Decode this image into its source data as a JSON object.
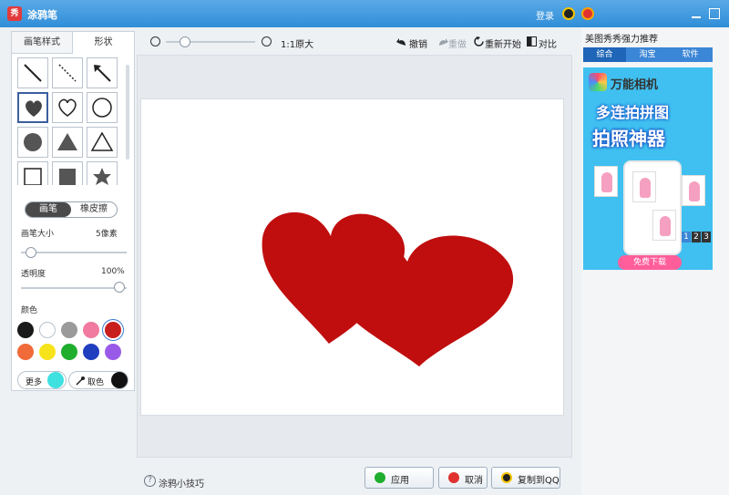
{
  "window": {
    "title": "涂鸦笔",
    "logo_char": "秀",
    "login_label": "登录"
  },
  "left_panel": {
    "tabs": [
      {
        "label": "画笔样式",
        "active": false
      },
      {
        "label": "形状",
        "active": true
      }
    ],
    "shapes": [
      {
        "name": "line",
        "selected": false
      },
      {
        "name": "dashed-line",
        "selected": false
      },
      {
        "name": "arrow",
        "selected": false
      },
      {
        "name": "heart-filled",
        "selected": true
      },
      {
        "name": "heart-outline",
        "selected": false
      },
      {
        "name": "circle-outline",
        "selected": false
      },
      {
        "name": "circle-filled",
        "selected": false
      },
      {
        "name": "triangle-filled",
        "selected": false
      },
      {
        "name": "triangle-outline",
        "selected": false
      },
      {
        "name": "square-outline",
        "selected": false
      },
      {
        "name": "square-filled",
        "selected": false
      },
      {
        "name": "star-filled",
        "selected": false
      }
    ],
    "mode_brush": "画笔",
    "mode_eraser": "橡皮擦",
    "brush_size_label": "画笔大小",
    "brush_size_value": "5像素",
    "opacity_label": "透明度",
    "opacity_value": "100%",
    "color_label": "颜色",
    "colors": [
      "#1a1a1a",
      "#ffffff",
      "#9a9a9a",
      "#f07aa0",
      "#c81e1e",
      "#f06a3a",
      "#f7e31a",
      "#1fae2e",
      "#1f3fbf",
      "#9a5ae8"
    ],
    "selected_color": "#c81e1e",
    "more_label": "更多",
    "more_color": "#3fe0e0",
    "picker_label": "取色",
    "picker_color": "#111111"
  },
  "toolbar": {
    "zoom_label": "1:1原大",
    "undo_label": "撤销",
    "redo_label": "重做",
    "restart_label": "重新开始",
    "compare_label": "对比"
  },
  "canvas": {
    "heart_color": "#c00e0e"
  },
  "footer": {
    "tips_label": "涂鸦小技巧",
    "apply_label": "应用",
    "cancel_label": "取消",
    "copy_qq_label": "复制到QQ"
  },
  "right_panel": {
    "title": "美图秀秀强力推荐",
    "tabs": [
      {
        "label": "综合",
        "active": true
      },
      {
        "label": "淘宝",
        "active": false
      },
      {
        "label": "软件",
        "active": false
      }
    ],
    "ad": {
      "brand": "万能相机",
      "line1": "多连拍拼图",
      "line2": "拍照神器",
      "download_label": "免费下载",
      "pages": [
        "1",
        "2",
        "3"
      ],
      "active_page": "1"
    }
  }
}
